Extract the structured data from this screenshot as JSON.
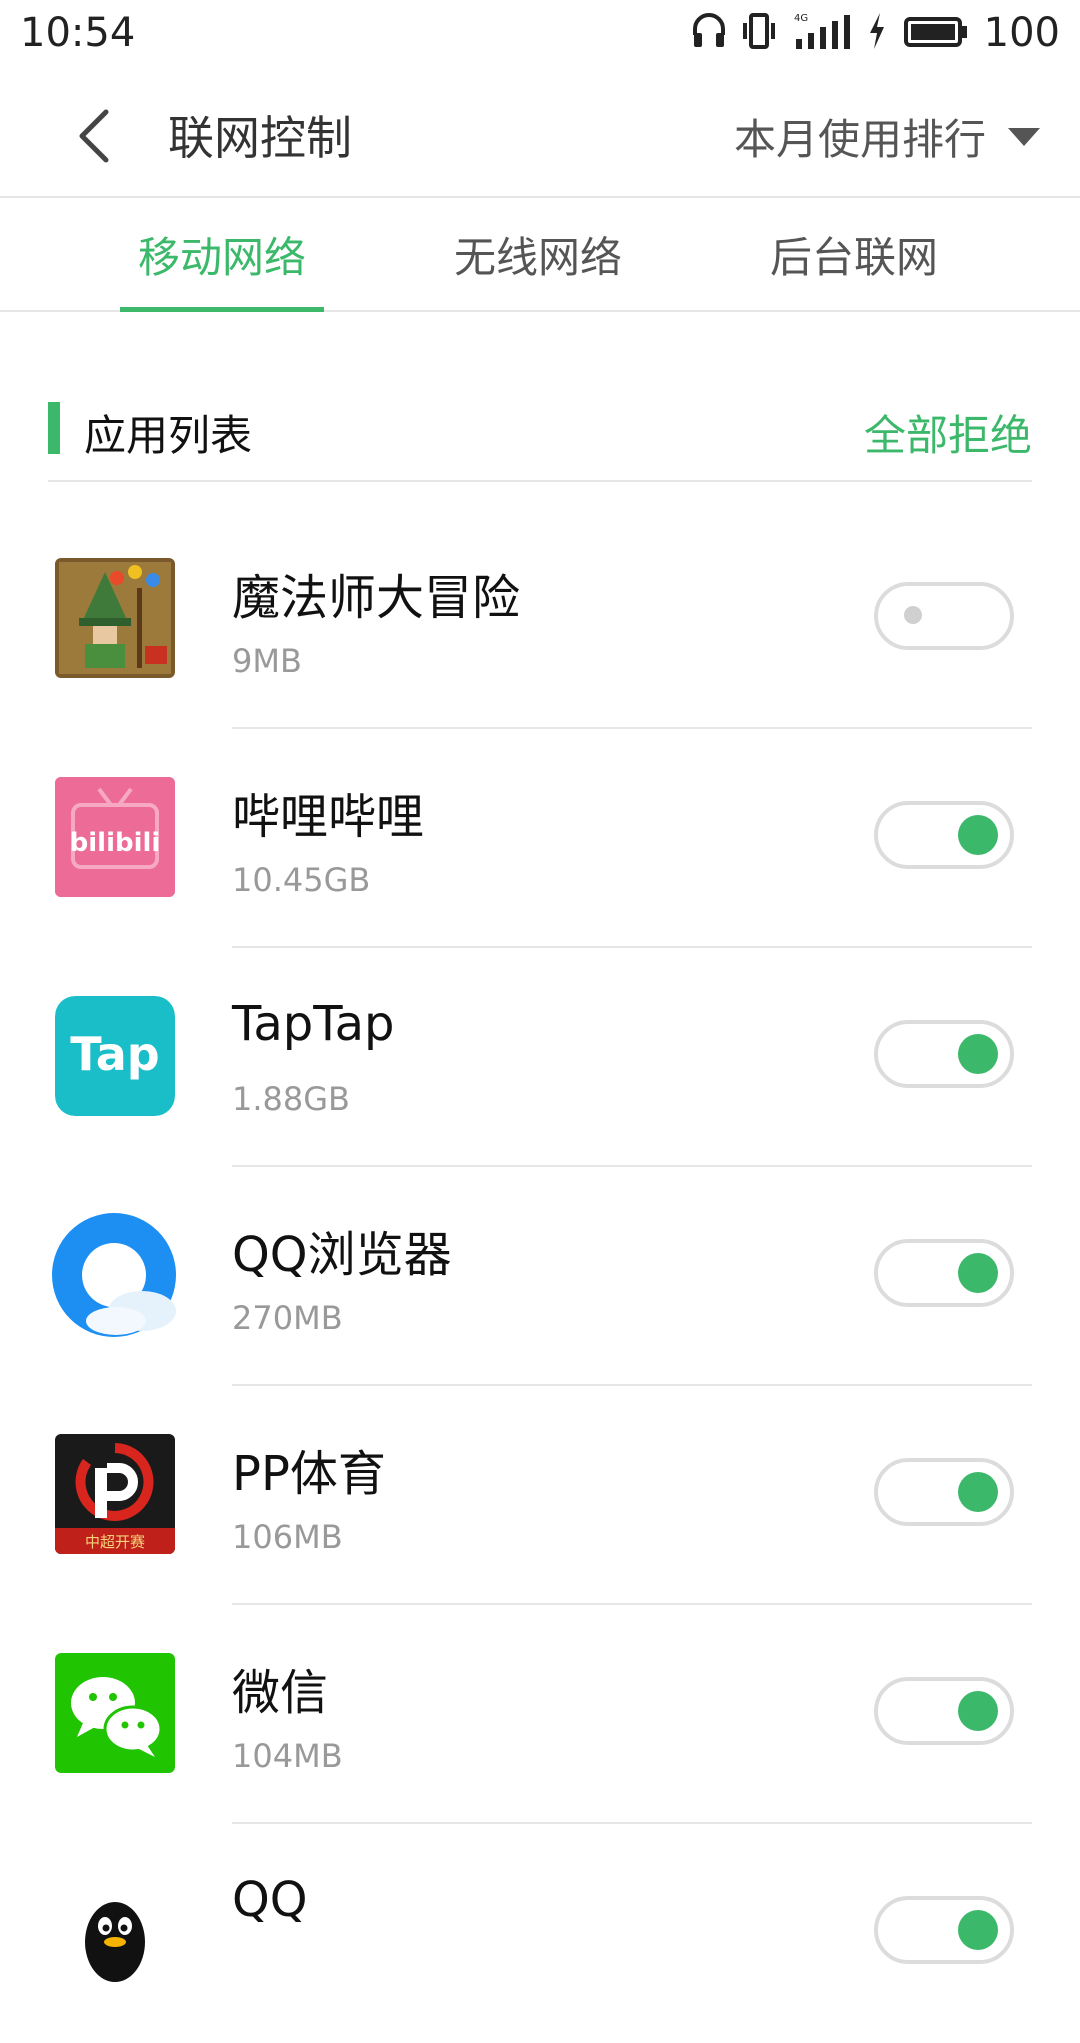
{
  "status_bar": {
    "time": "10:54",
    "network_label": "4G",
    "battery_level": "100",
    "icons": [
      "headphones-icon",
      "vibrate-icon",
      "signal-icon",
      "charging-icon",
      "battery-icon"
    ]
  },
  "nav": {
    "title": "联网控制",
    "sort_label": "本月使用排行",
    "icons": [
      "back-icon",
      "dropdown-triangle-icon"
    ]
  },
  "tabs": [
    {
      "label": "移动网络",
      "active": true
    },
    {
      "label": "无线网络",
      "active": false
    },
    {
      "label": "后台联网",
      "active": false
    }
  ],
  "section": {
    "title": "应用列表",
    "action_label": "全部拒绝"
  },
  "apps": [
    {
      "name": "魔法师大冒险",
      "usage": "9MB",
      "enabled": false,
      "icon": "wizard-game-icon"
    },
    {
      "name": "哔哩哔哩",
      "usage": "10.45GB",
      "enabled": true,
      "icon": "bilibili-icon",
      "icon_text": "bilibili"
    },
    {
      "name": "TapTap",
      "usage": "1.88GB",
      "enabled": true,
      "icon": "taptap-icon",
      "icon_text": "Tap"
    },
    {
      "name": "QQ浏览器",
      "usage": "270MB",
      "enabled": true,
      "icon": "qq-browser-icon"
    },
    {
      "name": "PP体育",
      "usage": "106MB",
      "enabled": true,
      "icon": "pp-sports-icon",
      "icon_text": "中超开赛"
    },
    {
      "name": "微信",
      "usage": "104MB",
      "enabled": true,
      "icon": "wechat-icon"
    },
    {
      "name": "QQ",
      "usage": "",
      "enabled": true,
      "icon": "qq-penguin-icon"
    }
  ],
  "colors": {
    "accent": "#3cb86b",
    "divider": "#e6e6e6",
    "subtext": "#999999"
  }
}
